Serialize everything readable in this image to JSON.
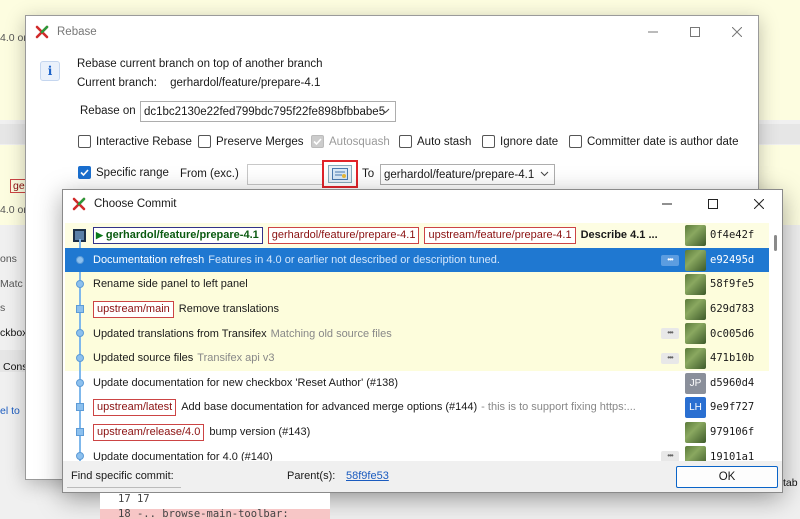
{
  "background": {
    "fragments": [
      "4.0 or",
      "ge",
      "4.0 or",
      "ons",
      "Matc",
      "s",
      "ckbox",
      "Cons",
      "el to",
      "tab"
    ]
  },
  "rebase_dialog": {
    "title": "Rebase",
    "intro": "Rebase current branch on top of another branch",
    "current_branch_label": "Current branch:",
    "current_branch": "gerhardol/feature/prepare-4.1",
    "rebase_on_label": "Rebase on",
    "rebase_on_value": "dc1bc2130e22fed799bdc795f22fe898bfbbabe5",
    "options": [
      {
        "label": "Interactive Rebase",
        "checked": false,
        "disabled": false
      },
      {
        "label": "Preserve Merges",
        "checked": false,
        "disabled": false
      },
      {
        "label": "Autosquash",
        "checked": true,
        "disabled": true
      },
      {
        "label": "Auto stash",
        "checked": false,
        "disabled": false
      },
      {
        "label": "Ignore date",
        "checked": false,
        "disabled": false
      },
      {
        "label": "Committer date is author date",
        "checked": false,
        "disabled": false
      }
    ],
    "specific_range_label": "Specific range",
    "specific_range_checked": true,
    "from_label": "From (exc.)",
    "from_value": "",
    "to_label": "To",
    "to_value": "gerhardol/feature/prepare-4.1"
  },
  "choose_commit": {
    "title": "Choose Commit",
    "commits": [
      {
        "refs": [
          {
            "label": "gerhardol/feature/prepare-4.1",
            "head": true
          },
          {
            "label": "gerhardol/feature/prepare-4.1"
          },
          {
            "label": "upstream/feature/prepare-4.1"
          }
        ],
        "message": "Describe 4.1 ...",
        "detail": "",
        "more": false,
        "avatar": "photo",
        "sha": "0f4e42f"
      },
      {
        "refs": [],
        "message": "Documentation refresh",
        "detail": "Features in 4.0 or earlier not described or description tuned.",
        "more": true,
        "avatar": "photo",
        "sha": "e92495d"
      },
      {
        "refs": [],
        "message": "Rename side panel to left panel",
        "detail": "",
        "more": false,
        "avatar": "photo",
        "sha": "58f9fe5"
      },
      {
        "refs": [
          {
            "label": "upstream/main"
          }
        ],
        "message": "Remove translations",
        "detail": "",
        "more": false,
        "avatar": "photo",
        "sha": "629d783"
      },
      {
        "refs": [],
        "message": "Updated translations from Transifex",
        "detail": "Matching old source files",
        "more": true,
        "avatar": "photo",
        "sha": "0c005d6"
      },
      {
        "refs": [],
        "message": "Updated source files",
        "detail": "Transifex api v3",
        "more": true,
        "avatar": "photo",
        "sha": "471b10b"
      },
      {
        "refs": [],
        "message": "Update documentation for new checkbox 'Reset Author' (#138)",
        "detail": "",
        "more": false,
        "avatar": "JP",
        "sha": "d5960d4"
      },
      {
        "refs": [
          {
            "label": "upstream/latest"
          }
        ],
        "message": "Add base documentation for advanced merge options (#144)",
        "detail": "- this is to support fixing https:...",
        "more": false,
        "avatar": "LH",
        "sha": "9e9f727"
      },
      {
        "refs": [
          {
            "label": "upstream/release/4.0"
          }
        ],
        "message": "bump version (#143)",
        "detail": "",
        "more": false,
        "avatar": "photo",
        "sha": "979106f"
      },
      {
        "refs": [],
        "message": "Update documentation for 4.0 (#140)",
        "detail": "",
        "more": true,
        "avatar": "photo",
        "sha": "19101a1"
      }
    ],
    "find_label": "Find specific commit:",
    "parents_label": "Parent(s):",
    "parent_sha": "58f9fe53",
    "ok_label": "OK"
  },
  "diff": {
    "line1": "17  17",
    "line2": "18    -.. browse-main-toolbar:"
  }
}
